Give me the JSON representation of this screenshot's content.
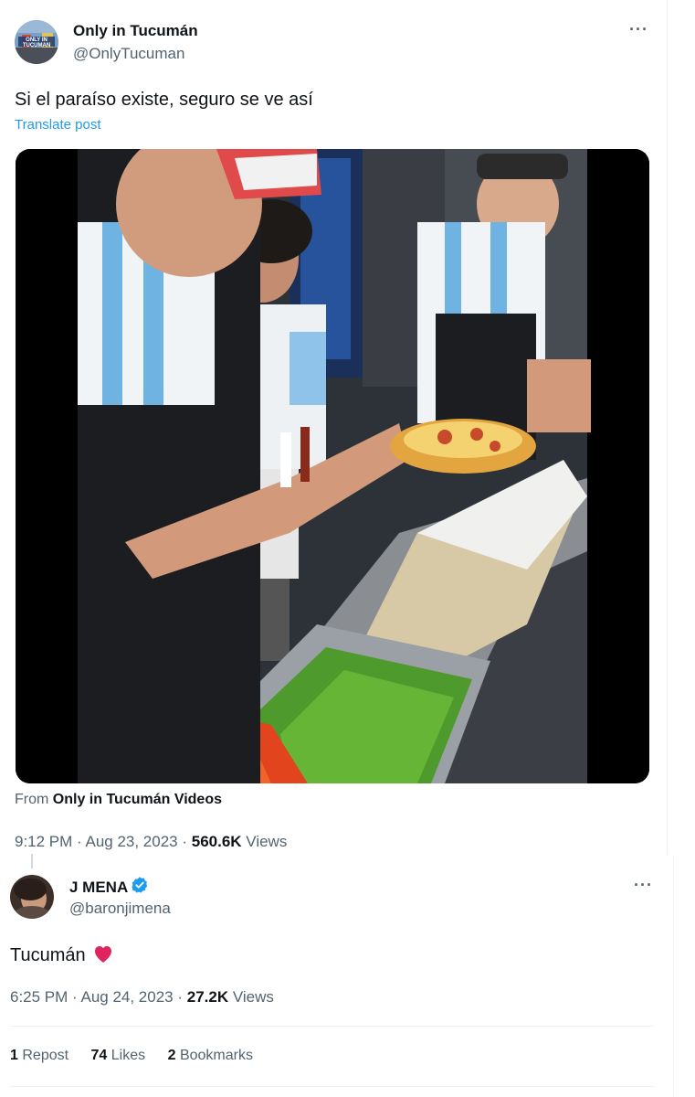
{
  "tweet": {
    "author_name": "Only in Tucumán",
    "author_handle": "@OnlyTucuman",
    "text": "Si el paraíso existe, seguro se ve así",
    "translate_label": "Translate post",
    "source_prefix": "From",
    "source_name": "Only in Tucumán Videos",
    "time_date": "9:12 PM · Aug 23, 2023 · ",
    "views_count": "560.6K",
    "views_label": " Views",
    "avatar_text": "ONLY IN TUCUMAN",
    "more_icon": "more-icon"
  },
  "reply": {
    "author_name": "J MENA",
    "author_handle": "@baronjimena",
    "text": "Tucumán",
    "time_date": "6:25 PM · Aug 24, 2023 · ",
    "views_count": "27.2K",
    "views_label": " Views",
    "reposts_count": "1",
    "reposts_label": "Repost",
    "likes_count": "74",
    "likes_label": "Likes",
    "bookmarks_count": "2",
    "bookmarks_label": "Bookmarks",
    "verified_icon": "verified-badge-icon",
    "emoji": "heart-icon"
  },
  "colors": {
    "link_blue": "#1d9bf0",
    "secondary_text": "#536471",
    "primary_text": "#0f1419"
  }
}
